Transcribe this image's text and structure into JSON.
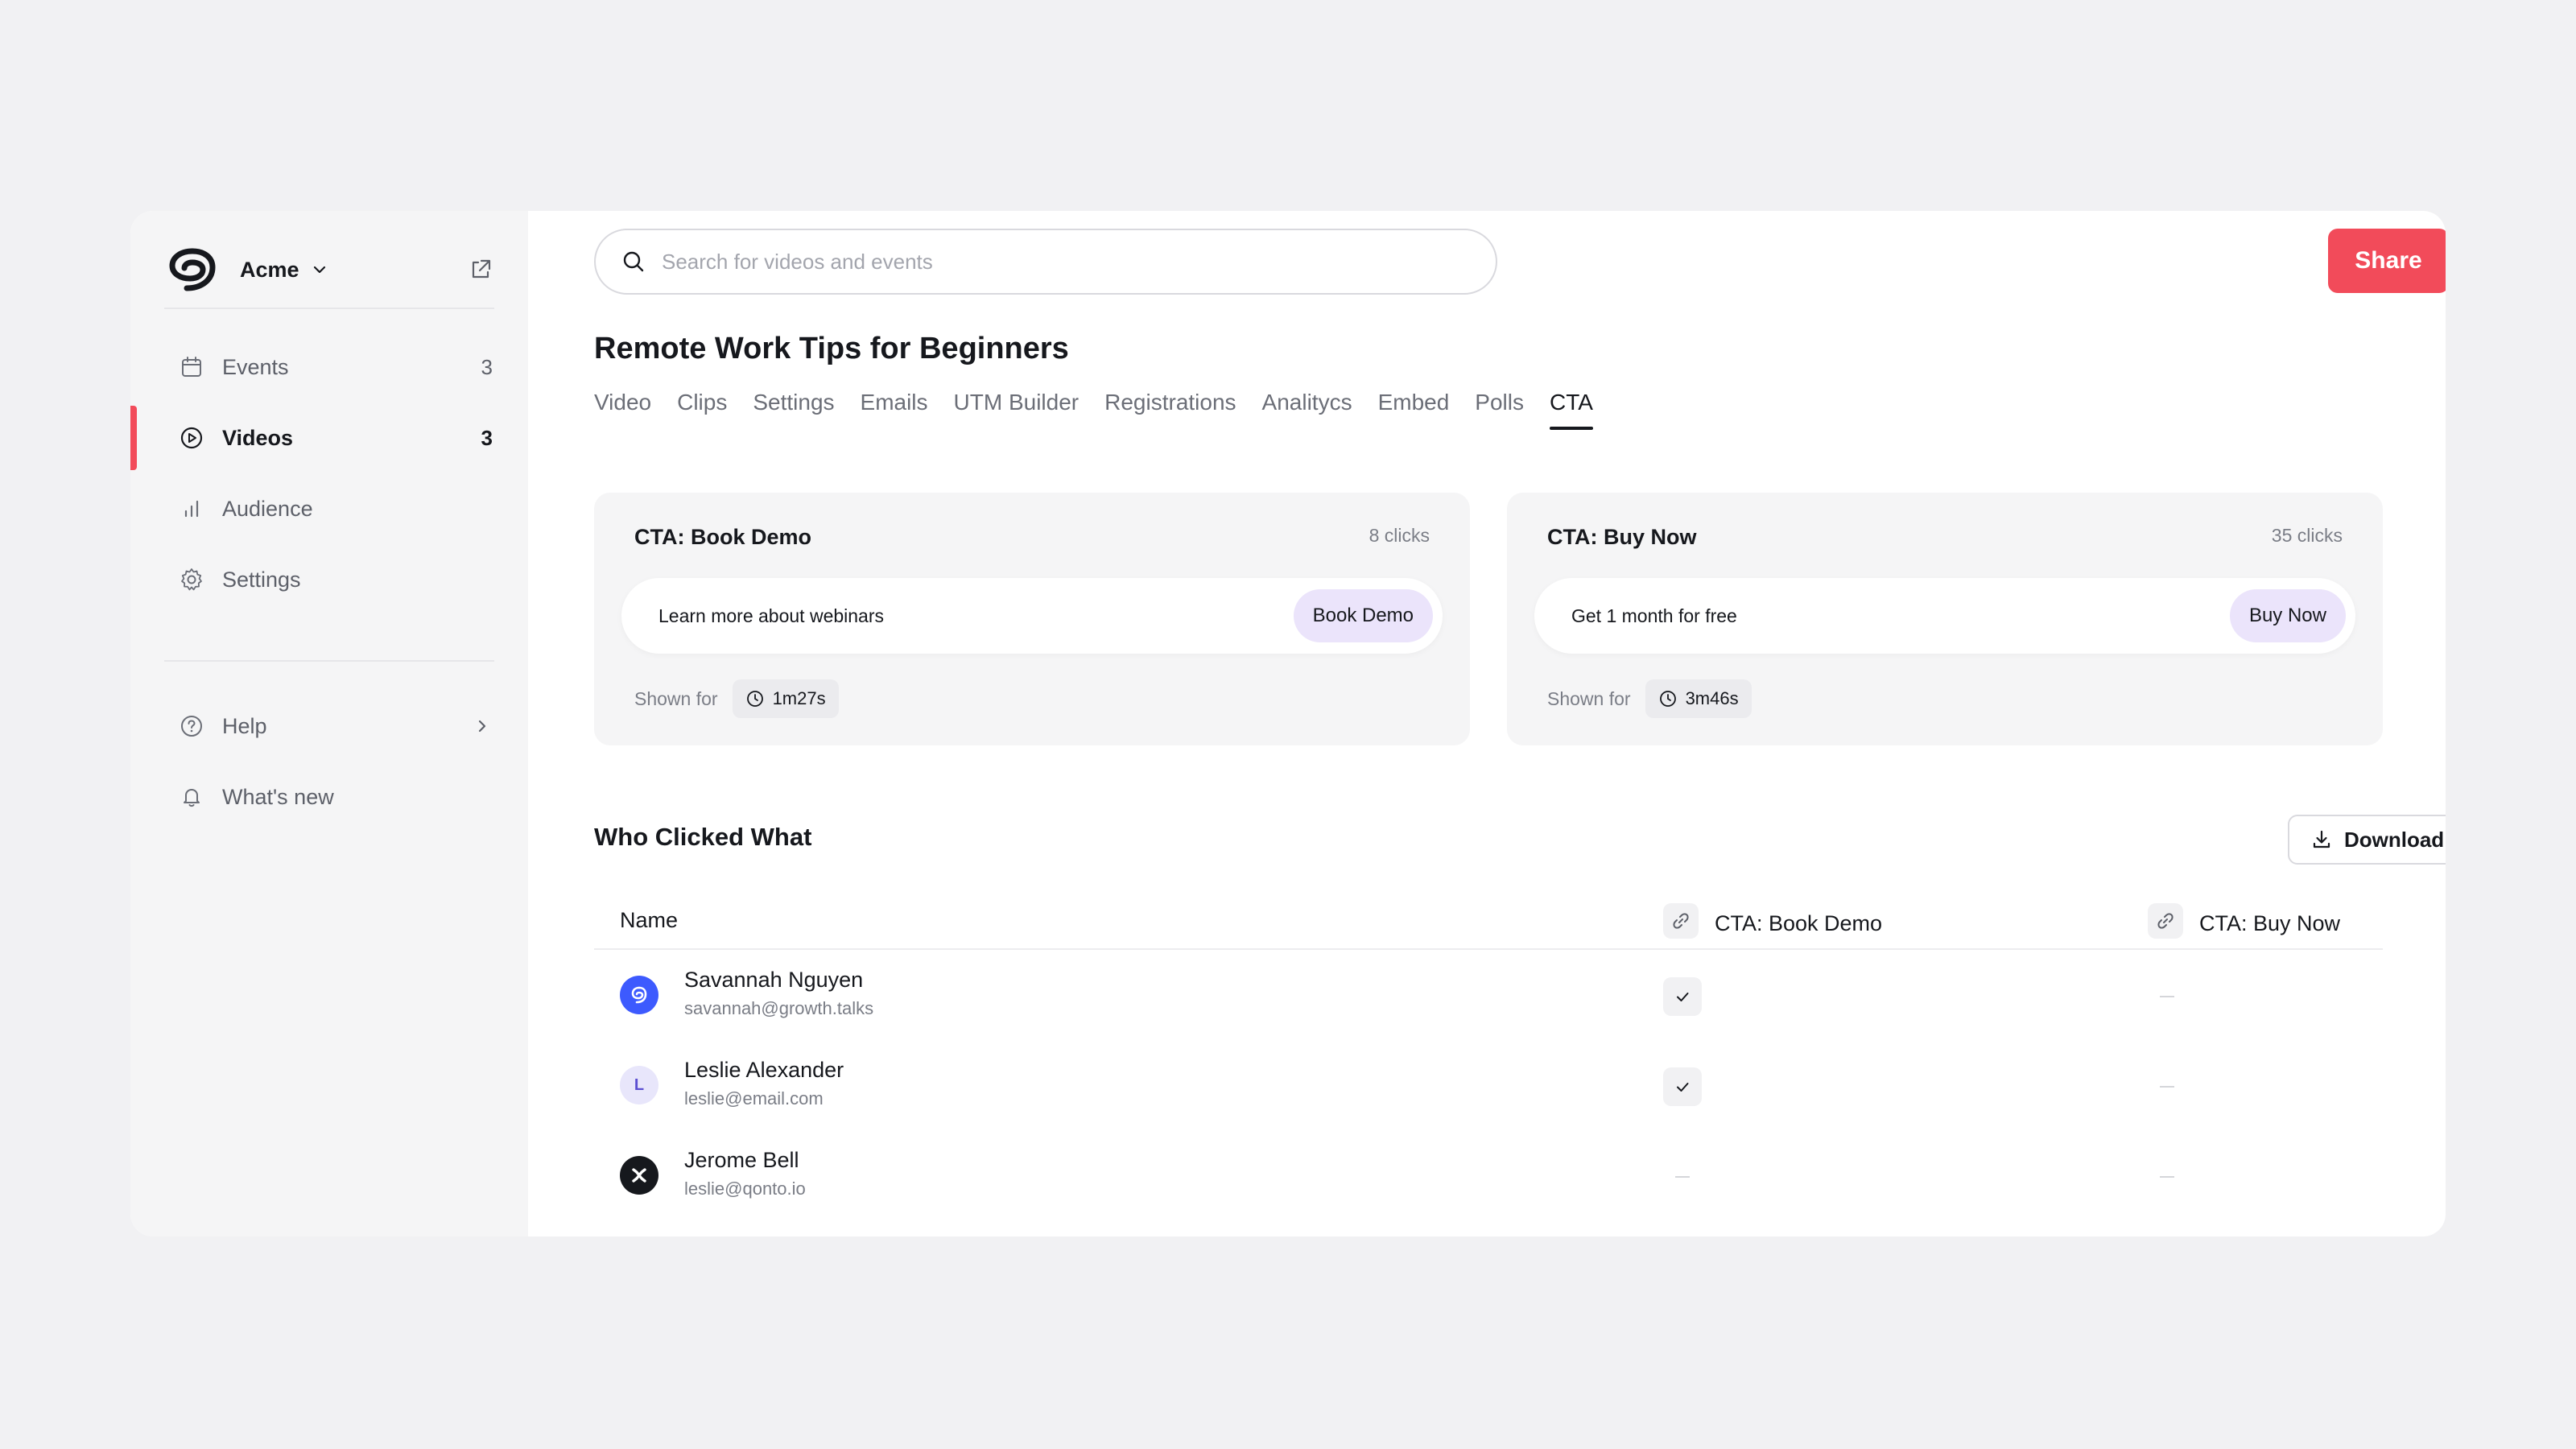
{
  "brand": {
    "name": "Acme"
  },
  "sidebar": {
    "items": [
      {
        "label": "Events",
        "count": "3"
      },
      {
        "label": "Videos",
        "count": "3"
      },
      {
        "label": "Audience",
        "count": ""
      },
      {
        "label": "Settings",
        "count": ""
      }
    ],
    "footer": [
      {
        "label": "Help"
      },
      {
        "label": "What's new"
      }
    ],
    "active_item": "Videos"
  },
  "search": {
    "placeholder": "Search for videos and events",
    "value": ""
  },
  "header": {
    "share_label": "Share"
  },
  "page": {
    "title": "Remote Work Tips for Beginners",
    "tabs": [
      "Video",
      "Clips",
      "Settings",
      "Emails",
      "UTM Builder",
      "Registrations",
      "Analitycs",
      "Embed",
      "Polls",
      "CTA"
    ],
    "active_tab": "CTA"
  },
  "cta_cards": [
    {
      "title": "CTA: Book Demo",
      "clicks": "8 clicks",
      "message": "Learn more about webinars",
      "button": "Book Demo",
      "shown_for_label": "Shown for",
      "shown_for": "1m27s"
    },
    {
      "title": "CTA: Buy Now",
      "clicks": "35 clicks",
      "message": "Get 1 month for free",
      "button": "Buy Now",
      "shown_for_label": "Shown for",
      "shown_for": "3m46s"
    }
  ],
  "who_clicked": {
    "title": "Who Clicked What",
    "download_label": "Download .csv",
    "columns": [
      "Name",
      "CTA: Book Demo",
      "CTA: Buy Now"
    ],
    "rows": [
      {
        "name": "Savannah Nguyen",
        "email": "savannah@growth.talks",
        "avatar": "brand-blue",
        "book_demo": true,
        "buy_now": false
      },
      {
        "name": "Leslie Alexander",
        "email": "leslie@email.com",
        "avatar_letter": "L",
        "book_demo": true,
        "buy_now": false
      },
      {
        "name": "Jerome Bell",
        "email": "leslie@qonto.io",
        "avatar": "black-x",
        "book_demo": false,
        "buy_now": false
      }
    ]
  },
  "colors": {
    "accent": "#f24b5a",
    "cta_button_bg": "#ebe4fb",
    "sidebar_bg": "#f5f5f6",
    "avatar_blue": "#3d5afe"
  }
}
